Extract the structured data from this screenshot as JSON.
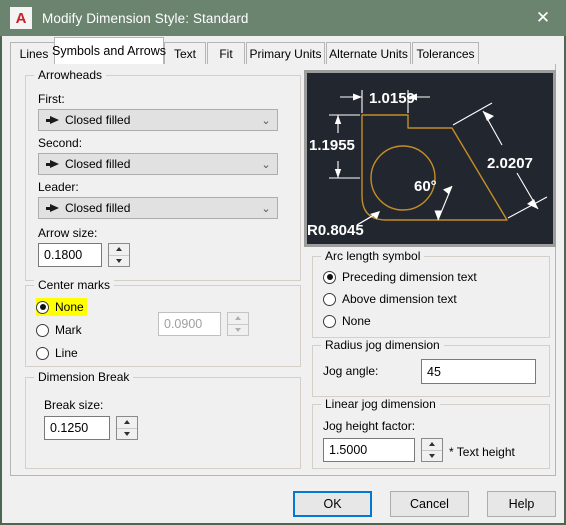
{
  "window": {
    "title": "Modify Dimension Style: Standard",
    "logo_glyph": "A",
    "close_glyph": "✕"
  },
  "tabs": [
    {
      "label": "Lines",
      "active": false
    },
    {
      "label": "Symbols and Arrows",
      "active": true
    },
    {
      "label": "Text",
      "active": false
    },
    {
      "label": "Fit",
      "active": false
    },
    {
      "label": "Primary Units",
      "active": false
    },
    {
      "label": "Alternate Units",
      "active": false
    },
    {
      "label": "Tolerances",
      "active": false
    }
  ],
  "arrowheads": {
    "group_label": "Arrowheads",
    "first_label": "First:",
    "first_value": "Closed filled",
    "second_label": "Second:",
    "second_value": "Closed filled",
    "leader_label": "Leader:",
    "leader_value": "Closed filled",
    "arrow_size_label": "Arrow size:",
    "arrow_size_value": "0.1800",
    "chevron": "⌄"
  },
  "center_marks": {
    "group_label": "Center marks",
    "options": [
      {
        "label": "None",
        "checked": true,
        "highlighted": true
      },
      {
        "label": "Mark",
        "checked": false,
        "highlighted": false
      },
      {
        "label": "Line",
        "checked": false,
        "highlighted": false
      }
    ],
    "size_value": "0.0900",
    "size_disabled": true
  },
  "dimension_break": {
    "group_label": "Dimension Break",
    "break_size_label": "Break size:",
    "break_size_value": "0.1250"
  },
  "arc_length_symbol": {
    "group_label": "Arc length symbol",
    "options": [
      {
        "label": "Preceding dimension text",
        "checked": true
      },
      {
        "label": "Above dimension text",
        "checked": false
      },
      {
        "label": "None",
        "checked": false
      }
    ]
  },
  "radius_jog": {
    "group_label": "Radius jog dimension",
    "jog_angle_label": "Jog angle:",
    "jog_angle_value": "45"
  },
  "linear_jog": {
    "group_label": "Linear jog dimension",
    "jog_height_label": "Jog height factor:",
    "jog_height_value": "1.5000",
    "suffix": "* Text height"
  },
  "footer": {
    "ok": "OK",
    "cancel": "Cancel",
    "help": "Help"
  },
  "preview": {
    "background": "#22272f",
    "geometry_color": "#c58c28",
    "dimension_color": "#ffffff",
    "labels": {
      "top": "1.0159",
      "left": "1.1955",
      "radius": "R0.8045",
      "angle": "60°",
      "diagonal": "2.0207"
    }
  },
  "colors": {
    "titlebar": "#6b8470",
    "dialog_bg": "#f0f0f0",
    "accent": "#0078d7",
    "highlight": "#ffff00",
    "logo_red": "#c8202a"
  }
}
